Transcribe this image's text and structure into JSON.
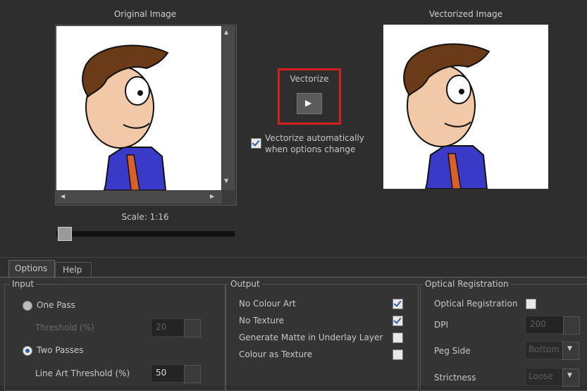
{
  "preview": {
    "original_title": "Original Image",
    "vectorized_title": "Vectorized Image",
    "scale_label": "Scale: 1:16",
    "vectorize_label": "Vectorize",
    "auto_vectorize_label": "Vectorize automatically when options change",
    "auto_vectorize_checked": true
  },
  "tabs": [
    "Options",
    "Help"
  ],
  "input": {
    "title": "Input",
    "one_pass_label": "One Pass",
    "threshold_label": "Threshold (%)",
    "threshold_value": "20",
    "two_passes_label": "Two Passes",
    "line_art_label": "Line Art Threshold (%)",
    "line_art_value": "50",
    "selected": "Two Passes"
  },
  "output": {
    "title": "Output",
    "items": [
      {
        "label": "No Colour Art",
        "checked": true
      },
      {
        "label": "No Texture",
        "checked": true
      },
      {
        "label": "Generate Matte in Underlay Layer",
        "checked": false
      },
      {
        "label": "Colour as Texture",
        "checked": false
      }
    ]
  },
  "optical": {
    "title": "Optical Registration",
    "opt_reg_label": "Optical Registration",
    "opt_reg_checked": false,
    "dpi_label": "DPI",
    "dpi_value": "200",
    "peg_side_label": "Peg Side",
    "peg_side_value": "Bottom",
    "strictness_label": "Strictness",
    "strictness_value": "Loose"
  },
  "colors": {
    "highlight": "#d41f1f",
    "background": "#2e2e2e"
  }
}
